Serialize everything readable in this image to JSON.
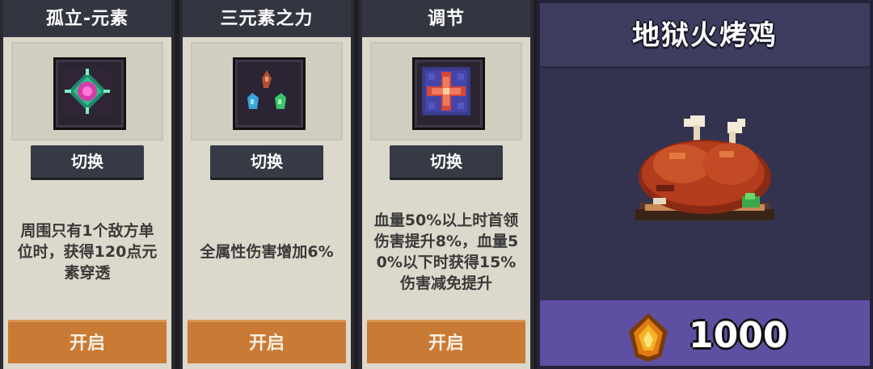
{
  "talents": [
    {
      "title": "孤立-元素",
      "icon": "isolated-element-icon",
      "switch_label": "切换",
      "desc_lines": [
        "周围只有1个敌方单",
        "位时，获得120点元",
        "素穿透"
      ],
      "enable_label": "开启"
    },
    {
      "title": "三元素之力",
      "icon": "three-elements-power-icon",
      "switch_label": "切换",
      "desc_lines": [
        "全属性伤害增加6%"
      ],
      "enable_label": "开启"
    },
    {
      "title": "调节",
      "icon": "adjust-cross-icon",
      "switch_label": "切换",
      "desc_lines": [
        "血量50%以上时首领",
        "伤害提升8%，血量5",
        "0%以下时获得15%",
        "伤害减免提升"
      ],
      "enable_label": "开启"
    }
  ],
  "item": {
    "name": "地狱火烤鸡",
    "icon": "roast-chicken-icon",
    "price": "1000",
    "currency_icon": "fire-gem-icon"
  },
  "colors": {
    "header_bg": "#333640",
    "panel_bg": "#dcd8cb",
    "button_dark": "#353a45",
    "button_orange": "#c97a34",
    "item_card_bg": "#3b3a5d",
    "price_bar_bg": "#5f4fa3"
  }
}
